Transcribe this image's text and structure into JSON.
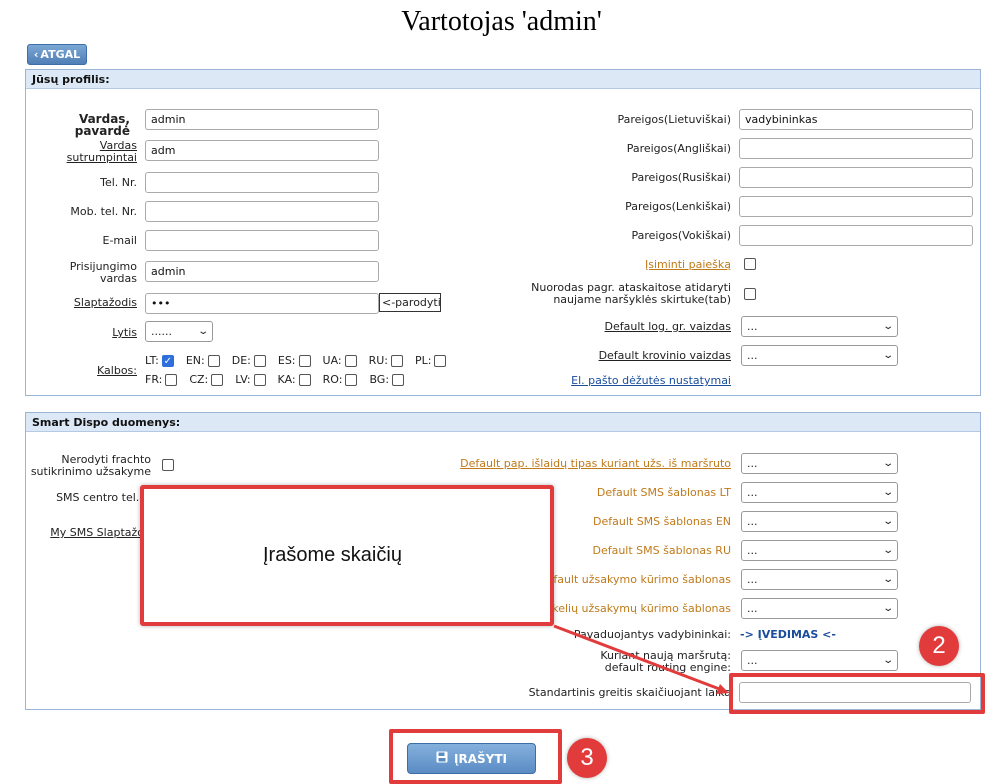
{
  "page": {
    "title": "Vartotojas 'admin'",
    "back_label": "ATGAL"
  },
  "profile": {
    "heading": "Jūsų profilis:",
    "fields": {
      "name_label": "Vardas, pavardė",
      "name_value": "admin",
      "short_label": "Vardas sutrumpintai",
      "short_value": "adm",
      "phone_label": "Tel. Nr.",
      "phone_value": "",
      "mobile_label": "Mob. tel. Nr.",
      "mobile_value": "",
      "email_label": "E-mail",
      "email_value": "",
      "login_label": "Prisijungimo vardas",
      "login_value": "admin",
      "password_label": "Slaptažodis",
      "password_value": "•••",
      "show_label": "<-parodyti",
      "gender_label": "Lytis",
      "gender_value": "......",
      "languages_label": "Kalbos:"
    },
    "languages": [
      {
        "code": "LT:",
        "checked": true
      },
      {
        "code": "EN:",
        "checked": false
      },
      {
        "code": "DE:",
        "checked": false
      },
      {
        "code": "ES:",
        "checked": false
      },
      {
        "code": "UA:",
        "checked": false
      },
      {
        "code": "RU:",
        "checked": false
      },
      {
        "code": "PL:",
        "checked": false
      },
      {
        "code": "FR:",
        "checked": false
      },
      {
        "code": "CZ:",
        "checked": false
      },
      {
        "code": "LV:",
        "checked": false
      },
      {
        "code": "KA:",
        "checked": false
      },
      {
        "code": "RO:",
        "checked": false
      },
      {
        "code": "BG:",
        "checked": false
      }
    ],
    "positions": {
      "lt_label": "Pareigos(Lietuviškai)",
      "lt_value": "vadybininkas",
      "en_label": "Pareigos(Angliškai)",
      "ru_label": "Pareigos(Rusiškai)",
      "pl_label": "Pareigos(Lenkiškai)",
      "de_label": "Pareigos(Vokiškai)"
    },
    "remember_search_label": "Įsiminti paiešką",
    "open_links_label": "Nuorodas pagr. ataskaitose atidaryti naujame naršyklės skirtuke(tab)",
    "default_log_label": "Default log. gr. vaizdas",
    "default_log_value": "...",
    "default_cargo_label": "Default krovinio vaizdas",
    "default_cargo_value": "...",
    "mailbox_link": "El. pašto dėžutės nustatymai"
  },
  "smart": {
    "heading": "Smart Dispo duomenys:",
    "no_freight_label": "Nerodyti frachto sutikrinimo užsakyme",
    "sms_phone_label": "SMS centro tel. N",
    "my_sms_password_label": "My SMS Slaptažod",
    "expense_type_label": "Default pap. išlaidų tipas kuriant užs. iš maršruto",
    "sms_lt_label": "Default SMS šablonas LT",
    "sms_en_label": "Default SMS šablonas EN",
    "sms_ru_label": "Default SMS šablonas RU",
    "order_template_label": "efault užsakymo kūrimo šablonas",
    "multi_order_template_label": "kelių užsakymų kūrimo šablonas",
    "managers_label": "Pavaduojantys vadybininkai:",
    "managers_link": "-> ĮVEDIMAS <-",
    "routing_label": "Kuriant naują maršrutą: default routing engine:",
    "speed_label": "Standartinis greitis skaičiuojant laika",
    "select_value": "..."
  },
  "callout": {
    "text": "Įrašome skaičių"
  },
  "badges": {
    "two": "2",
    "three": "3"
  },
  "save_label": "ĮRAŠYTI",
  "colors": {
    "accent": "#e23b3b",
    "button": "#5a8cc4",
    "label_orange": "#c07a1a",
    "link_blue": "#1a4d9c"
  }
}
